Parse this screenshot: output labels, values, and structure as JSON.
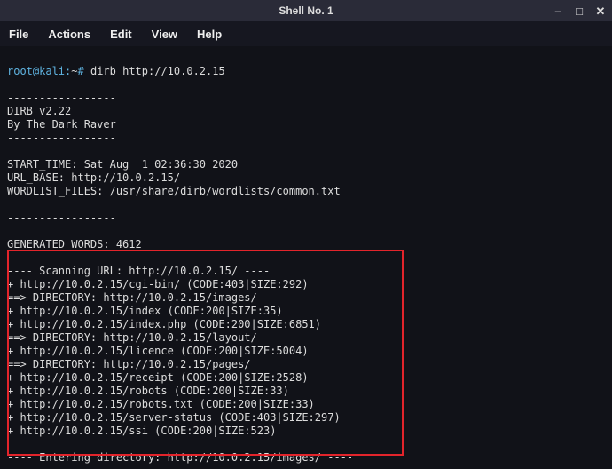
{
  "window": {
    "title": "Shell No. 1"
  },
  "menu": {
    "file": "File",
    "actions": "Actions",
    "edit": "Edit",
    "view": "View",
    "help": "Help"
  },
  "prompt": {
    "userhost": "root@kali",
    "colon": ":",
    "path": "~",
    "symbol": "#",
    "command": "dirb http://10.0.2.15"
  },
  "output": {
    "sep": "-----------------",
    "version": "DIRB v2.22",
    "by": "By The Dark Raver",
    "start_time": "START_TIME: Sat Aug  1 02:36:30 2020",
    "url_base": "URL_BASE: http://10.0.2.15/",
    "wordlist": "WORDLIST_FILES: /usr/share/dirb/wordlists/common.txt",
    "gen_words": "GENERATED WORDS: 4612",
    "scan_head": "---- Scanning URL: http://10.0.2.15/ ----",
    "r1": "+ http://10.0.2.15/cgi-bin/ (CODE:403|SIZE:292)",
    "r2": "==> DIRECTORY: http://10.0.2.15/images/",
    "r3": "+ http://10.0.2.15/index (CODE:200|SIZE:35)",
    "r4": "+ http://10.0.2.15/index.php (CODE:200|SIZE:6851)",
    "r5": "==> DIRECTORY: http://10.0.2.15/layout/",
    "r6": "+ http://10.0.2.15/licence (CODE:200|SIZE:5004)",
    "r7": "==> DIRECTORY: http://10.0.2.15/pages/",
    "r8": "+ http://10.0.2.15/receipt (CODE:200|SIZE:2528)",
    "r9": "+ http://10.0.2.15/robots (CODE:200|SIZE:33)",
    "r10": "+ http://10.0.2.15/robots.txt (CODE:200|SIZE:33)",
    "r11": "+ http://10.0.2.15/server-status (CODE:403|SIZE:297)",
    "r12": "+ http://10.0.2.15/ssi (CODE:200|SIZE:523)",
    "enter_dir": "---- Entering directory: http://10.0.2.15/images/ ----"
  }
}
